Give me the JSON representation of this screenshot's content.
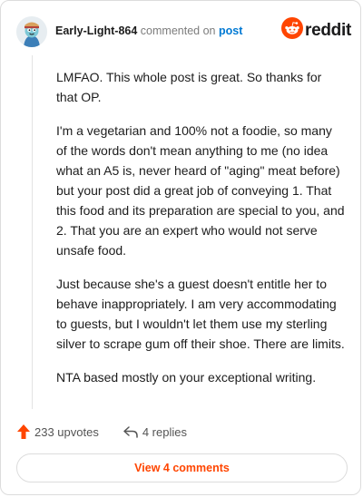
{
  "header": {
    "username": "Early-Light-864",
    "action_text": "commented on",
    "post_link": "post"
  },
  "brand": {
    "wordmark": "reddit",
    "accent_color": "#ff4500",
    "icon": "reddit-snoo-icon"
  },
  "avatar": {
    "icon": "user-avatar-icon"
  },
  "comment": {
    "paragraphs": [
      "LMFAO. This whole post is great. So thanks for that OP.",
      "I'm a vegetarian and 100% not a foodie, so many of the words don't mean anything to me (no idea what an A5 is, never heard of \"aging\" meat before) but your post did a great job of conveying 1. That this food and its preparation are special to you, and 2. That you are an expert who would not serve unsafe food.",
      "Just because she's a guest doesn't entitle her to behave inappropriately. I am very accommodating to guests, but I wouldn't let them use my sterling silver to scrape gum off their shoe. There are limits.",
      "NTA based mostly on your exceptional writing."
    ]
  },
  "actions": {
    "upvotes": "233 upvotes",
    "upvote_icon": "upvote-arrow-icon",
    "replies": "4 replies",
    "reply_icon": "reply-arrow-icon"
  },
  "footer": {
    "view_comments": "View 4 comments"
  }
}
